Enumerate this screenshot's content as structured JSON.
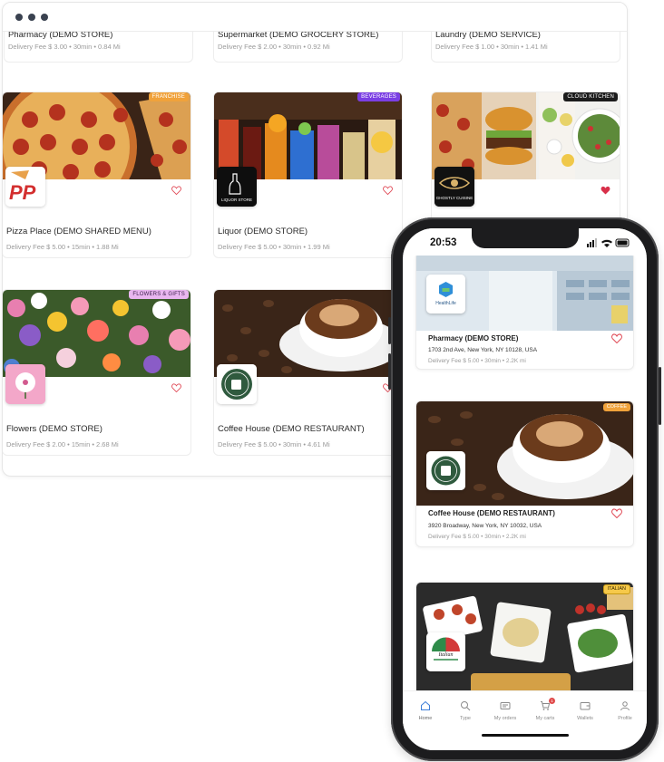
{
  "browser": {
    "top_row": [
      {
        "title": "Pharmacy (DEMO STORE)",
        "meta": "Delivery Fee  $ 3.00 • 30min • 0.84 Mi"
      },
      {
        "title": "Supermarket (DEMO GROCERY STORE)",
        "meta": "Delivery Fee  $ 2.00 • 30min • 0.92 Mi"
      },
      {
        "title": "Laundry (DEMO SERVICE)",
        "meta": "Delivery Fee  $ 1.00 • 30min • 1.41 Mi"
      }
    ],
    "cards": [
      {
        "title": "Pizza Place (DEMO SHARED MENU)",
        "meta": "Delivery Fee  $ 5.00 • 15min • 1.88 Mi",
        "badge": "Franchise",
        "badge_color": "#f0a23b",
        "logo": "PP",
        "favorited": false
      },
      {
        "title": "Liquor (DEMO STORE)",
        "meta": "Delivery Fee  $ 5.00 • 30min • 1.99 Mi",
        "badge": "Beverages",
        "badge_color": "#7b3fe4",
        "logo": "LIQUOR STORE",
        "favorited": false
      },
      {
        "title": "",
        "meta": "",
        "badge": "Cloud Kitchen",
        "badge_color": "#1c1c1c",
        "logo": "GHOSTLY CUISINE",
        "favorited": true
      },
      {
        "title": "Flowers (DEMO STORE)",
        "meta": "Delivery Fee  $ 2.00 • 15min • 2.68 Mi",
        "badge": "Flowers & Gifts",
        "badge_color": "#e9b6f0",
        "logo": "flower-icon",
        "favorited": false
      },
      {
        "title": "Coffee House (DEMO RESTAURANT)",
        "meta": "Delivery Fee  $ 5.00 • 30min • 4.61 Mi",
        "badge": "",
        "badge_color": "#f0a23b",
        "logo": "coffee-icon",
        "favorited": false
      }
    ]
  },
  "phone": {
    "status_time": "20:53",
    "cards": [
      {
        "title": "Pharmacy (DEMO STORE)",
        "address": "1703 2nd Ave, New York, NY 10128, USA",
        "meta": "Delivery Fee $ 5.00 • 30min • 2.2K mi",
        "badge": "",
        "logo": "HealthLife"
      },
      {
        "title": "Coffee House (DEMO RESTAURANT)",
        "address": "3920 Broadway, New York, NY 10032, USA",
        "meta": "Delivery Fee $ 5.00 • 30min • 2.2K mi",
        "badge": "Coffee",
        "badge_color": "#f0a23b",
        "logo": "coffee-icon"
      },
      {
        "title": "",
        "address": "",
        "meta": "",
        "badge": "Italian",
        "badge_color": "#f6c94a",
        "logo": "Italian"
      }
    ],
    "tabs": [
      {
        "label": "Home",
        "icon": "home-icon"
      },
      {
        "label": "Type",
        "icon": "search-icon"
      },
      {
        "label": "My orders",
        "icon": "orders-icon"
      },
      {
        "label": "My carts",
        "icon": "cart-icon",
        "badge": "1"
      },
      {
        "label": "Wallets",
        "icon": "wallet-icon"
      },
      {
        "label": "Profile",
        "icon": "profile-icon"
      }
    ]
  },
  "colors": {
    "heart": "#e04b57",
    "heart_filled": "#d8304a",
    "accent_orange": "#f0a23b"
  }
}
